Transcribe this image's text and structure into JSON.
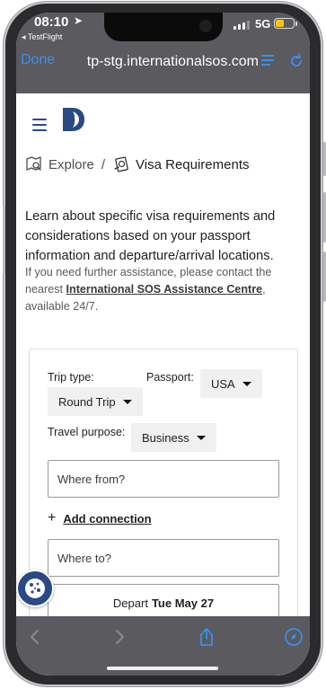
{
  "status_bar": {
    "time": "08:10",
    "back_app": "◂ TestFlight",
    "network": "5G",
    "battery_level": 0.45
  },
  "browser": {
    "done_label": "Done",
    "url": "tp-stg.internationalsos.com",
    "reader_icon": "reader-mode-icon",
    "reload_icon": "reload-icon"
  },
  "header": {
    "menu_icon": "hamburger-menu-icon",
    "logo": "international-sos-logo"
  },
  "breadcrumb": {
    "items": [
      {
        "label": "Explore",
        "icon": "map-search-icon"
      },
      {
        "label": "Visa Requirements",
        "icon": "passport-icon"
      }
    ],
    "separator": "/"
  },
  "intro": {
    "text": "Learn about specific visa requirements and considerations based on your passport information and departure/arrival locations.",
    "help_prefix": "If you need further assistance, please contact the nearest",
    "help_link": "International SOS Assistance Centre",
    "help_suffix": ", available 24/7."
  },
  "form": {
    "trip_type_label": "Trip type:",
    "trip_type_value": "Round Trip",
    "passport_label": "Passport:",
    "passport_value": "USA",
    "purpose_label": "Travel purpose:",
    "purpose_value": "Business",
    "from_placeholder": "Where from?",
    "add_connection_label": "Add connection",
    "to_placeholder": "Where to?",
    "depart_label": "Depart",
    "depart_date": "Tue May 27"
  },
  "colors": {
    "brand": "#2a4a86",
    "safari_bar": "#5a5a5f",
    "link_blue": "#3d8ff0"
  }
}
